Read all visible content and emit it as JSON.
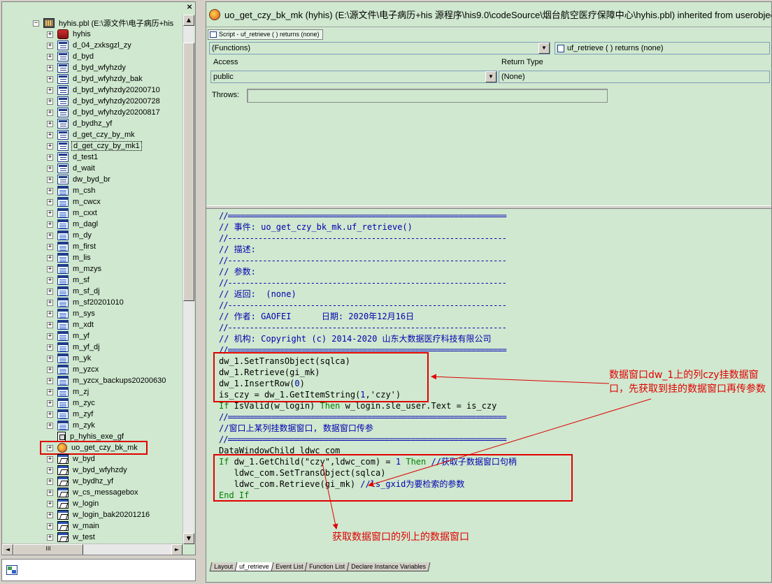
{
  "tree": {
    "close_glyph": "×",
    "root_label": "hyhis.pbl (E:\\源文件\\电子病历+his",
    "items": [
      {
        "label": "hyhis",
        "icon": "application-icon",
        "expand": "+"
      },
      {
        "label": "d_04_zxksgzl_zy",
        "icon": "datawindow-icon",
        "expand": "+"
      },
      {
        "label": "d_byd",
        "icon": "datawindow-icon",
        "expand": "+"
      },
      {
        "label": "d_byd_wfyhzdy",
        "icon": "datawindow-icon",
        "expand": "+"
      },
      {
        "label": "d_byd_wfyhzdy_bak",
        "icon": "datawindow-icon",
        "expand": "+"
      },
      {
        "label": "d_byd_wfyhzdy20200710",
        "icon": "datawindow-icon",
        "expand": "+"
      },
      {
        "label": "d_byd_wfyhzdy20200728",
        "icon": "datawindow-icon",
        "expand": "+"
      },
      {
        "label": "d_byd_wfyhzdy20200817",
        "icon": "datawindow-icon",
        "expand": "+"
      },
      {
        "label": "d_bydhz_yf",
        "icon": "datawindow-icon",
        "expand": "+"
      },
      {
        "label": "d_get_czy_by_mk",
        "icon": "datawindow-icon",
        "expand": "+"
      },
      {
        "label": "d_get_czy_by_mk1",
        "icon": "datawindow-icon",
        "expand": "+",
        "selected": true
      },
      {
        "label": "d_test1",
        "icon": "datawindow-icon",
        "expand": "+"
      },
      {
        "label": "d_wait",
        "icon": "datawindow-icon",
        "expand": "+"
      },
      {
        "label": "dw_byd_br",
        "icon": "datawindow-icon",
        "expand": "+"
      },
      {
        "label": "m_csh",
        "icon": "menu-icon",
        "expand": "+"
      },
      {
        "label": "m_cwcx",
        "icon": "menu-icon",
        "expand": "+"
      },
      {
        "label": "m_cxxt",
        "icon": "menu-icon",
        "expand": "+"
      },
      {
        "label": "m_dagl",
        "icon": "menu-icon",
        "expand": "+"
      },
      {
        "label": "m_dy",
        "icon": "menu-icon",
        "expand": "+"
      },
      {
        "label": "m_first",
        "icon": "menu-icon",
        "expand": "+"
      },
      {
        "label": "m_lis",
        "icon": "menu-icon",
        "expand": "+"
      },
      {
        "label": "m_mzys",
        "icon": "menu-icon",
        "expand": "+"
      },
      {
        "label": "m_sf",
        "icon": "menu-icon",
        "expand": "+"
      },
      {
        "label": "m_sf_dj",
        "icon": "menu-icon",
        "expand": "+"
      },
      {
        "label": "m_sf20201010",
        "icon": "menu-icon",
        "expand": "+"
      },
      {
        "label": "m_sys",
        "icon": "menu-icon",
        "expand": "+"
      },
      {
        "label": "m_xdt",
        "icon": "menu-icon",
        "expand": "+"
      },
      {
        "label": "m_yf",
        "icon": "menu-icon",
        "expand": "+"
      },
      {
        "label": "m_yf_dj",
        "icon": "menu-icon",
        "expand": "+"
      },
      {
        "label": "m_yk",
        "icon": "menu-icon",
        "expand": "+"
      },
      {
        "label": "m_yzcx",
        "icon": "menu-icon",
        "expand": "+"
      },
      {
        "label": "m_yzcx_backups20200630",
        "icon": "menu-icon",
        "expand": "+"
      },
      {
        "label": "m_zj",
        "icon": "menu-icon",
        "expand": "+"
      },
      {
        "label": "m_zyc",
        "icon": "menu-icon",
        "expand": "+"
      },
      {
        "label": "m_zyf",
        "icon": "menu-icon",
        "expand": "+"
      },
      {
        "label": "m_zyk",
        "icon": "menu-icon",
        "expand": "+"
      },
      {
        "label": "p_hyhis_exe_gf",
        "icon": "project-icon",
        "expand": ""
      },
      {
        "label": "uo_get_czy_bk_mk",
        "icon": "user-object-icon",
        "expand": "+",
        "highlighted": true
      },
      {
        "label": "w_byd",
        "icon": "window-icon",
        "expand": "+"
      },
      {
        "label": "w_byd_wfyhzdy",
        "icon": "window-icon",
        "expand": "+"
      },
      {
        "label": "w_bydhz_yf",
        "icon": "window-icon",
        "expand": "+"
      },
      {
        "label": "w_cs_messagebox",
        "icon": "window-icon",
        "expand": "+"
      },
      {
        "label": "w_login",
        "icon": "window-icon",
        "expand": "+"
      },
      {
        "label": "w_login_bak20201216",
        "icon": "window-icon",
        "expand": "+"
      },
      {
        "label": "w_main",
        "icon": "window-icon",
        "expand": "+"
      },
      {
        "label": "w_test",
        "icon": "window-icon",
        "expand": "+"
      }
    ],
    "scroll_up": "▲",
    "scroll_down": "▼",
    "scroll_left": "◄",
    "scroll_right": "►",
    "hthumb_grip": "III"
  },
  "editor": {
    "title": "uo_get_czy_bk_mk (hyhis) (E:\\源文件\\电子病历+his 源程序\\his9.0\\codeSource\\烟台航空医疗保障中心\\hyhis.pbl) inherited from userobject - U",
    "script_tab": "Script - uf_retrieve ( ) returns (none)",
    "functions_combo": "(Functions)",
    "signature_combo": "uf_retrieve ( ) returns (none)",
    "access_label": "Access",
    "access_value": "public",
    "return_type_label": "Return Type",
    "return_type_value": "(None)",
    "throws_label": "Throws:",
    "throws_value": "",
    "dropdown_glyph": "▼"
  },
  "code": {
    "lines": [
      {
        "parts": [
          {
            "c": "c-sep",
            "t": "//================================================================"
          }
        ]
      },
      {
        "parts": [
          {
            "c": "c-comment",
            "t": "// 事件: uo_get_czy_bk_mk.uf_retrieve()"
          }
        ]
      },
      {
        "parts": [
          {
            "c": "c-sep",
            "t": "//----------------------------------------------------------------"
          }
        ]
      },
      {
        "parts": [
          {
            "c": "c-comment",
            "t": "// 描述:"
          }
        ]
      },
      {
        "parts": [
          {
            "c": "c-sep",
            "t": "//----------------------------------------------------------------"
          }
        ]
      },
      {
        "parts": [
          {
            "c": "c-comment",
            "t": "// 参数:"
          }
        ]
      },
      {
        "parts": [
          {
            "c": "c-sep",
            "t": "//----------------------------------------------------------------"
          }
        ]
      },
      {
        "parts": [
          {
            "c": "c-comment",
            "t": "// 返回:  (none)"
          }
        ]
      },
      {
        "parts": [
          {
            "c": "c-sep",
            "t": "//----------------------------------------------------------------"
          }
        ]
      },
      {
        "parts": [
          {
            "c": "c-comment",
            "t": "// 作者: GAOFEI      日期: 2020年12月16日"
          }
        ]
      },
      {
        "parts": [
          {
            "c": "c-sep",
            "t": "//----------------------------------------------------------------"
          }
        ]
      },
      {
        "parts": [
          {
            "c": "c-comment",
            "t": "// 机构: Copyright (c) 2014-2020 山东大数据医疗科技有限公司"
          }
        ]
      },
      {
        "parts": [
          {
            "c": "c-sep",
            "t": "//================================================================"
          }
        ]
      },
      {
        "parts": [
          {
            "c": "",
            "t": "dw_1.SetTransObject(sqlca)"
          }
        ]
      },
      {
        "parts": [
          {
            "c": "",
            "t": "dw_1.Retrieve(gi_mk)"
          }
        ]
      },
      {
        "parts": [
          {
            "c": "",
            "t": "dw_1.InsertRow("
          },
          {
            "c": "c-num",
            "t": "0"
          },
          {
            "c": "",
            "t": ")"
          }
        ]
      },
      {
        "parts": [
          {
            "c": "",
            "t": "is_czy = dw_1.GetItemString("
          },
          {
            "c": "c-num",
            "t": "1"
          },
          {
            "c": "",
            "t": ","
          },
          {
            "c": "c-str",
            "t": "'czy'"
          },
          {
            "c": "",
            "t": ")"
          }
        ]
      },
      {
        "parts": [
          {
            "c": "c-kw",
            "t": "If"
          },
          {
            "c": "",
            "t": " IsValid(w_login) "
          },
          {
            "c": "c-kw",
            "t": "Then"
          },
          {
            "c": "",
            "t": " w_login.sle_user.Text = is_czy"
          }
        ]
      },
      {
        "parts": [
          {
            "c": "c-sep",
            "t": "//================================================================"
          }
        ]
      },
      {
        "parts": [
          {
            "c": "c-comment",
            "t": "//窗口上某列挂数据窗口, 数据窗口传参"
          }
        ]
      },
      {
        "parts": [
          {
            "c": "c-sep",
            "t": "//================================================================"
          }
        ]
      },
      {
        "parts": [
          {
            "c": "",
            "t": "DataWindowChild ldwc_com"
          }
        ]
      },
      {
        "parts": [
          {
            "c": "c-kw",
            "t": "If"
          },
          {
            "c": "",
            "t": " dw_1.GetChild("
          },
          {
            "c": "c-str",
            "t": "\"czy\""
          },
          {
            "c": "",
            "t": ",ldwc_com) = "
          },
          {
            "c": "c-num",
            "t": "1"
          },
          {
            "c": "",
            "t": " "
          },
          {
            "c": "c-kw",
            "t": "Then"
          },
          {
            "c": "",
            "t": " "
          },
          {
            "c": "c-comment",
            "t": "//获取子数据窗口句柄"
          }
        ]
      },
      {
        "parts": [
          {
            "c": "",
            "t": "   ldwc_com.SetTransObject(sqlca)"
          }
        ]
      },
      {
        "parts": [
          {
            "c": "",
            "t": "   ldwc_com.Retrieve(gi_mk) "
          },
          {
            "c": "c-comment",
            "t": "//ls_gxid为要检索的参数"
          }
        ]
      },
      {
        "parts": [
          {
            "c": "c-kw",
            "t": "End If"
          }
        ]
      }
    ]
  },
  "annotations": {
    "right_note": "数据窗口dw_1上的列czy挂数据窗口，先获取到挂的数据窗口再传参数",
    "bottom_note": "获取数据窗口的列上的数据窗口",
    "color": "#e00000"
  },
  "bottom_tabs": [
    {
      "label": "Layout",
      "active": false
    },
    {
      "label": "uf_retrieve",
      "active": true
    },
    {
      "label": "Event List",
      "active": false
    },
    {
      "label": "Function List",
      "active": false
    },
    {
      "label": "Declare Instance Variables",
      "active": false
    }
  ]
}
